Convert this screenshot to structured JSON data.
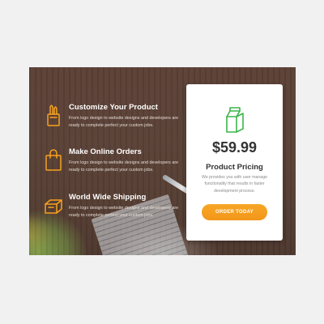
{
  "colors": {
    "accent_orange": "#f7a11e",
    "icon_green": "#3bb54a",
    "background": "#5a4136",
    "card": "#ffffff"
  },
  "features": [
    {
      "icon": "pencil-cup-icon",
      "title": "Customize Your Product",
      "desc": "From logo design to website designs and developers are ready to complete perfect your custom jobs."
    },
    {
      "icon": "shopping-bag-icon",
      "title": "Make Online Orders",
      "desc": "From logo design to website designs and developers are ready to complete perfect your custom jobs."
    },
    {
      "icon": "shipping-box-icon",
      "title": "World Wide Shipping",
      "desc": "From logo design to website designs and developers are ready to complete perfect your custom jobs."
    }
  ],
  "pricing": {
    "icon": "milk-carton-icon",
    "price": "$59.99",
    "heading": "Product Pricing",
    "description": "We provides you with user manage functionality that results in faster development process.",
    "cta_label": "ORDER TODAY"
  }
}
